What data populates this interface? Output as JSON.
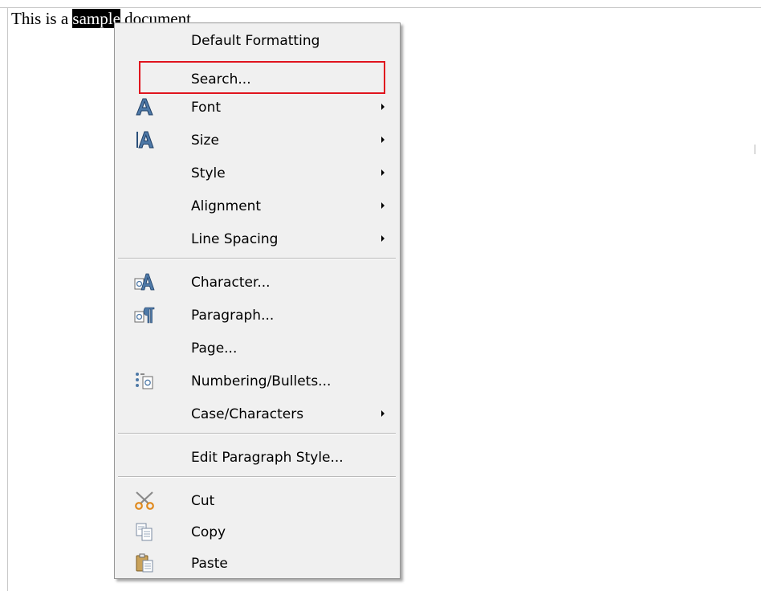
{
  "document": {
    "text_before": "This is a ",
    "text_selected": "sample",
    "text_after": " document"
  },
  "context_menu": {
    "items": [
      {
        "label": "Default Formatting",
        "has_submenu": false,
        "icon": "",
        "highlighted": false
      },
      {
        "label": "Search...",
        "has_submenu": false,
        "icon": "",
        "highlighted": true
      },
      {
        "label": "Font",
        "has_submenu": true,
        "icon": "font-icon",
        "highlighted": false
      },
      {
        "label": "Size",
        "has_submenu": true,
        "icon": "font-size-icon",
        "highlighted": false
      },
      {
        "label": "Style",
        "has_submenu": true,
        "icon": "",
        "highlighted": false
      },
      {
        "label": "Alignment",
        "has_submenu": true,
        "icon": "",
        "highlighted": false
      },
      {
        "label": "Line Spacing",
        "has_submenu": true,
        "icon": "",
        "highlighted": false
      },
      {
        "label": "Character...",
        "has_submenu": false,
        "icon": "character-icon",
        "highlighted": false
      },
      {
        "label": "Paragraph...",
        "has_submenu": false,
        "icon": "paragraph-icon",
        "highlighted": false
      },
      {
        "label": "Page...",
        "has_submenu": false,
        "icon": "",
        "highlighted": false
      },
      {
        "label": "Numbering/Bullets...",
        "has_submenu": false,
        "icon": "numbering-bullets-icon",
        "highlighted": false
      },
      {
        "label": "Case/Characters",
        "has_submenu": true,
        "icon": "",
        "highlighted": false
      },
      {
        "label": "Edit Paragraph Style...",
        "has_submenu": false,
        "icon": "",
        "highlighted": false
      },
      {
        "label": "Cut",
        "has_submenu": false,
        "icon": "cut-icon",
        "highlighted": false
      },
      {
        "label": "Copy",
        "has_submenu": false,
        "icon": "copy-icon",
        "highlighted": false
      },
      {
        "label": "Paste",
        "has_submenu": false,
        "icon": "paste-icon",
        "highlighted": false
      }
    ]
  },
  "colors": {
    "menu_background": "#f0f0f0",
    "highlight_border": "#e0141e",
    "selection_background": "#000000"
  }
}
